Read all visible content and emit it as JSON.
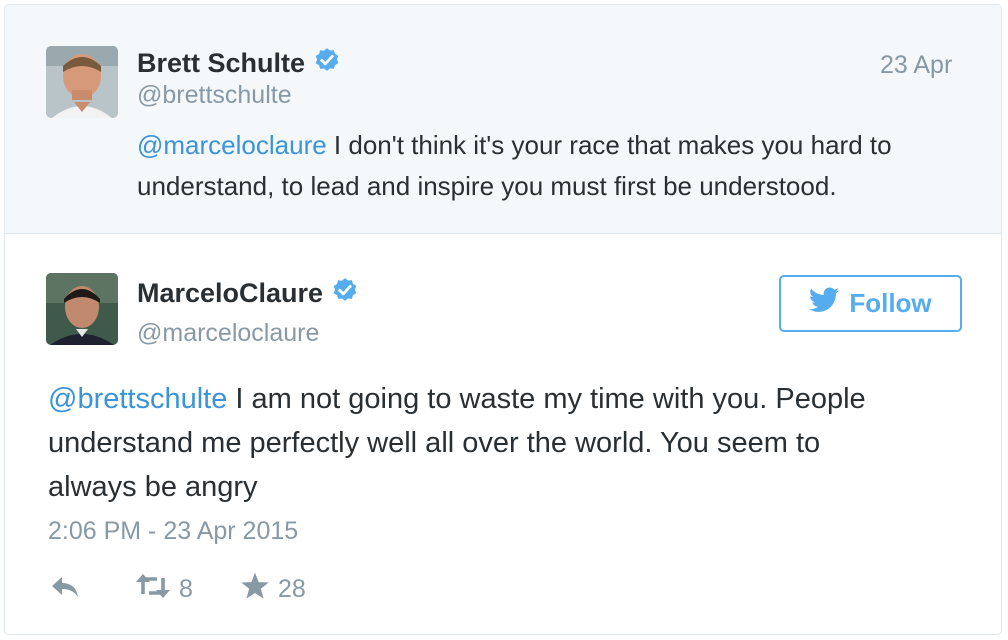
{
  "parent_tweet": {
    "name": "Brett Schulte",
    "handle": "@brettschulte",
    "date": "23 Apr",
    "mention": "@marceloclaure",
    "text_line1": " I don't think it's your race that makes you hard to",
    "text_line2": "understand, to lead and inspire you must first be understood.",
    "verified_icon": "verified-badge-icon"
  },
  "main_tweet": {
    "name": "MarceloClaure",
    "handle": "@marceloclaure",
    "mention": "@brettschulte",
    "text_line1": " I am not going to waste my time with you. People",
    "text_line2": "understand me perfectly well all over the world. You seem to",
    "text_line3": "always be angry",
    "timestamp": "2:06 PM - 23 Apr 2015",
    "follow_label": "Follow",
    "retweet_count": "8",
    "favorite_count": "28",
    "verified_icon": "verified-badge-icon"
  },
  "colors": {
    "link": "#3b94d9",
    "follow": "#55acee",
    "muted": "#8899a6",
    "text": "#292f33",
    "parent_bg": "#f5f8fa",
    "verified": "#55acee"
  },
  "icons": [
    "twitter-bird-icon",
    "reply-icon",
    "retweet-icon",
    "star-icon"
  ]
}
